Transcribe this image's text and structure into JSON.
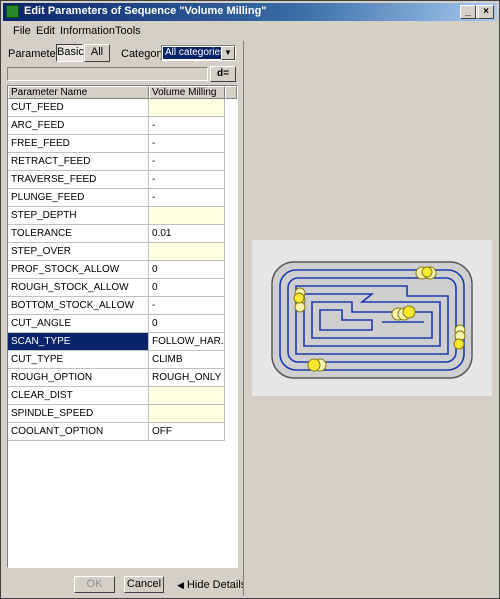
{
  "window": {
    "title": "Edit Parameters of Sequence \"Volume Milling\"",
    "controls": [
      "_",
      "□",
      "×"
    ]
  },
  "menu": [
    "File",
    "Edit",
    "Information",
    "Tools"
  ],
  "toolbar": {
    "parameters_label": "Parameters",
    "basic_tab": "Basic",
    "all_tab": "All",
    "category_label": "Category:",
    "category_value": "All categories",
    "filter_value": "",
    "deq_button": "d="
  },
  "grid": {
    "columns": [
      "Parameter Name",
      "Volume Milling"
    ],
    "rows": [
      {
        "name": "CUT_FEED",
        "value": "",
        "required": true
      },
      {
        "name": "ARC_FEED",
        "value": "-",
        "required": false
      },
      {
        "name": "FREE_FEED",
        "value": "-",
        "required": false
      },
      {
        "name": "RETRACT_FEED",
        "value": "-",
        "required": false
      },
      {
        "name": "TRAVERSE_FEED",
        "value": "-",
        "required": false
      },
      {
        "name": "PLUNGE_FEED",
        "value": "-",
        "required": false
      },
      {
        "name": "STEP_DEPTH",
        "value": "",
        "required": true
      },
      {
        "name": "TOLERANCE",
        "value": "0.01",
        "required": false
      },
      {
        "name": "STEP_OVER",
        "value": "",
        "required": true
      },
      {
        "name": "PROF_STOCK_ALLOW",
        "value": "0",
        "required": false
      },
      {
        "name": "ROUGH_STOCK_ALLOW",
        "value": "0",
        "required": false
      },
      {
        "name": "BOTTOM_STOCK_ALLOW",
        "value": "-",
        "required": false
      },
      {
        "name": "CUT_ANGLE",
        "value": "0",
        "required": false
      },
      {
        "name": "SCAN_TYPE",
        "value": "FOLLOW_HAR...",
        "required": false,
        "selected": true
      },
      {
        "name": "CUT_TYPE",
        "value": "CLIMB",
        "required": false
      },
      {
        "name": "ROUGH_OPTION",
        "value": "ROUGH_ONLY",
        "required": false
      },
      {
        "name": "CLEAR_DIST",
        "value": "",
        "required": true
      },
      {
        "name": "SPINDLE_SPEED",
        "value": "",
        "required": true
      },
      {
        "name": "COOLANT_OPTION",
        "value": "OFF",
        "required": false
      }
    ]
  },
  "buttons": {
    "ok": "OK",
    "cancel": "Cancel",
    "hide_details": "Hide Details"
  },
  "colors": {
    "title_start": "#0a246a",
    "selection": "#0a246a",
    "required_cell": "#ffffe1",
    "toolpath": "#1a3ab0"
  }
}
